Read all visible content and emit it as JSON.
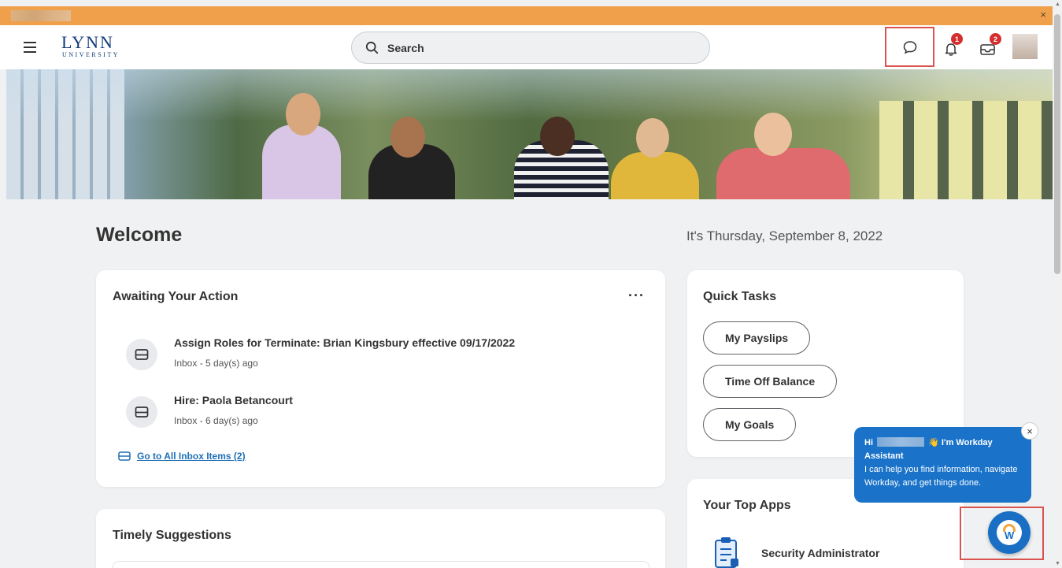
{
  "banner": {
    "close_glyph": "×"
  },
  "header": {
    "logo_main": "LYNN",
    "logo_sub": "UNIVERSITY",
    "search_placeholder": "Search",
    "notifications_count": "1",
    "inbox_count": "2"
  },
  "page": {
    "welcome": "Welcome",
    "date": "It's Thursday, September 8, 2022"
  },
  "awaiting": {
    "title": "Awaiting Your Action",
    "more": "···",
    "items": [
      {
        "title": "Assign Roles for Terminate: Brian Kingsbury effective 09/17/2022",
        "sub": "Inbox - 5 day(s) ago"
      },
      {
        "title": "Hire: Paola Betancourt",
        "sub": "Inbox - 6 day(s) ago"
      }
    ],
    "go_all": "Go to All Inbox Items (2)"
  },
  "timely": {
    "title": "Timely Suggestions"
  },
  "quick_tasks": {
    "title": "Quick Tasks",
    "buttons": [
      "My Payslips",
      "Time Off Balance",
      "My Goals"
    ]
  },
  "top_apps": {
    "title": "Your Top Apps",
    "apps": [
      "Security Administrator"
    ]
  },
  "assistant": {
    "greeting": "Hi",
    "intro": "I'm Workday Assistant",
    "wave": "👋",
    "body": "I can help you find information, navigate Workday, and get things done.",
    "close_glyph": "×",
    "logo_letter": "W"
  },
  "colors": {
    "banner": "#f0a04b",
    "primary": "#1a73c9",
    "badge": "#d32f2f",
    "highlight": "#d9534f",
    "logo": "#123b7a"
  }
}
